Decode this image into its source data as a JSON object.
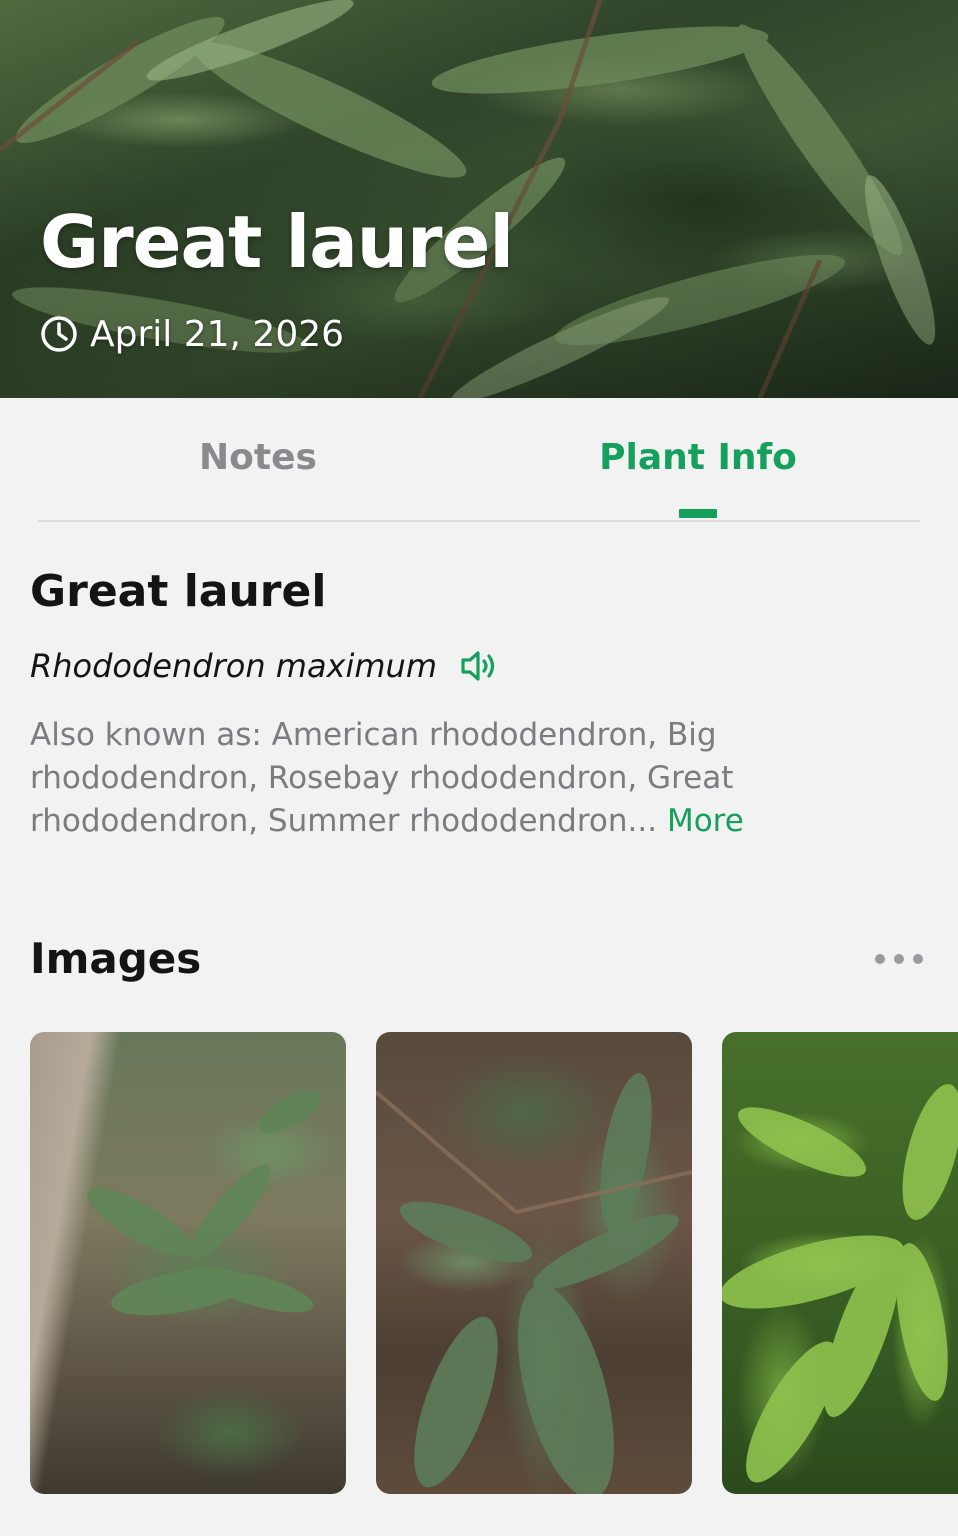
{
  "hero": {
    "title": "Great laurel",
    "date": "April 21, 2026"
  },
  "tabs": [
    {
      "label": "Notes",
      "active": false
    },
    {
      "label": "Plant Info",
      "active": true
    }
  ],
  "plant": {
    "common_name": "Great laurel",
    "scientific_name": "Rhododendron maximum",
    "aka_text": "Also known as: American rhododendron, Big rhododendron, Rosebay rhododendron, Great rhododendron, Summer rhododendron...",
    "more_label": "More"
  },
  "images_section": {
    "title": "Images",
    "thumbnail_count": 3
  },
  "colors": {
    "accent": "#16a05d",
    "background": "#f2f2f3",
    "text_primary": "#141414",
    "text_secondary": "#7b7b80"
  },
  "icons": {
    "date": "clock-icon",
    "pronounce": "speaker-icon",
    "overflow": "more-dots-icon"
  }
}
